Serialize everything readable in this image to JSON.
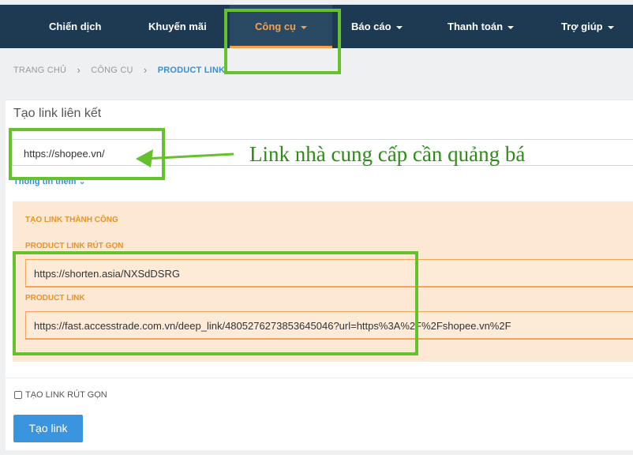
{
  "nav": {
    "items": [
      {
        "label": "Chiến dịch",
        "dropdown": false
      },
      {
        "label": "Khuyến mãi",
        "dropdown": false
      },
      {
        "label": "Công cụ",
        "dropdown": true,
        "active": true
      },
      {
        "label": "Báo cáo",
        "dropdown": true
      },
      {
        "label": "Thanh toán",
        "dropdown": true
      },
      {
        "label": "Trợ giúp",
        "dropdown": true
      }
    ]
  },
  "breadcrumb": [
    "TRANG CHỦ",
    "CÔNG CỤ",
    "PRODUCT LINK"
  ],
  "card": {
    "title": "Tạo link liên kết",
    "url_value": "https://shopee.vn/",
    "more_info": "Thông tin thêm"
  },
  "result": {
    "title": "TẠO LINK THÀNH CÔNG",
    "short_label": "PRODUCT LINK RÚT GỌN",
    "short_value": "https://shorten.asia/NXSdDSRG",
    "long_label": "PRODUCT LINK",
    "long_value": "https://fast.accesstrade.com.vn/deep_link/4805276273853645046?url=https%3A%2F%2Fshopee.vn%2F"
  },
  "options": {
    "shorten_label": "TẠO LINK RÚT GỌN",
    "shorten_checked": false
  },
  "actions": {
    "create_label": "Tạo link"
  },
  "annotation": {
    "text": "Link nhà cung cấp cần quảng bá"
  },
  "colors": {
    "nav_bg": "#1d3a52",
    "accent": "#f5a04a",
    "link_blue": "#3a8ed8",
    "highlight": "#66c22c",
    "success_bg": "#fde8d3"
  }
}
